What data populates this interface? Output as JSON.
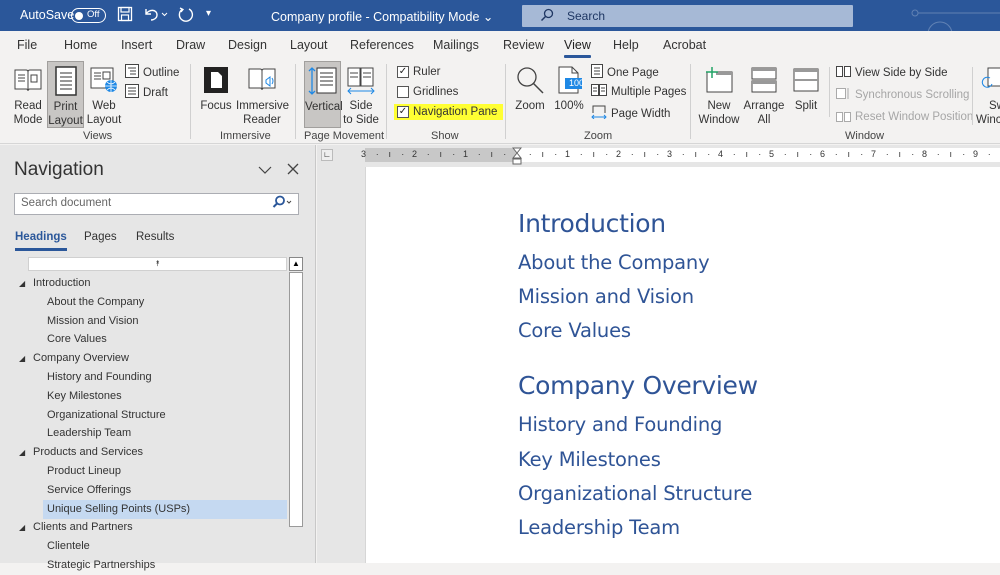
{
  "titlebar": {
    "autosave_label": "AutoSave",
    "autosave_state": "Off",
    "document_title": "Company profile  -  Compatibility Mode",
    "search_placeholder": "Search",
    "icons": [
      "save-icon",
      "undo-icon",
      "redo-icon",
      "customize-quick-access-icon"
    ]
  },
  "menu_tabs": [
    {
      "label": "File"
    },
    {
      "label": "Home"
    },
    {
      "label": "Insert"
    },
    {
      "label": "Draw"
    },
    {
      "label": "Design"
    },
    {
      "label": "Layout"
    },
    {
      "label": "References"
    },
    {
      "label": "Mailings"
    },
    {
      "label": "Review"
    },
    {
      "label": "View",
      "active": true
    },
    {
      "label": "Help"
    },
    {
      "label": "Acrobat"
    }
  ],
  "ribbon": {
    "views": {
      "label": "Views",
      "read_mode": "Read Mode",
      "print_layout_1": "Print",
      "print_layout_2": "Layout",
      "web_layout_1": "Web",
      "web_layout_2": "Layout",
      "read_mode_1": "Read",
      "read_mode_2": "Mode",
      "outline": "Outline",
      "draft": "Draft"
    },
    "immersive": {
      "label": "Immersive",
      "focus": "Focus",
      "reader_1": "Immersive",
      "reader_2": "Reader"
    },
    "page_movement": {
      "label": "Page Movement",
      "vertical": "Vertical",
      "side_1": "Side",
      "side_2": "to Side"
    },
    "show": {
      "label": "Show",
      "ruler": "Ruler",
      "ruler_checked": true,
      "gridlines": "Gridlines",
      "gridlines_checked": false,
      "navigation_pane": "Navigation Pane",
      "navigation_pane_checked": true
    },
    "zoom": {
      "label": "Zoom",
      "zoom": "Zoom",
      "hundred": "100%",
      "hundred_badge": "100",
      "one_page": "One Page",
      "multiple_pages": "Multiple Pages",
      "page_width": "Page Width"
    },
    "window": {
      "label": "Window",
      "new_1": "New",
      "new_2": "Window",
      "arrange_1": "Arrange",
      "arrange_2": "All",
      "split": "Split",
      "side_by_side": "View Side by Side",
      "sync_scroll": "Synchronous Scrolling",
      "reset_pos": "Reset Window Position",
      "switch_1": "Sw",
      "switch_2": "Winc"
    }
  },
  "navigation": {
    "title": "Navigation",
    "search_placeholder": "Search document",
    "tabs": [
      {
        "label": "Headings",
        "active": true
      },
      {
        "label": "Pages"
      },
      {
        "label": "Results"
      }
    ],
    "collapse_glyph": "⯭",
    "tree": [
      {
        "label": "Introduction",
        "level": 1
      },
      {
        "label": "About the Company",
        "level": 2
      },
      {
        "label": "Mission and Vision",
        "level": 2
      },
      {
        "label": "Core Values",
        "level": 2
      },
      {
        "label": "Company Overview",
        "level": 1
      },
      {
        "label": "History and Founding",
        "level": 2
      },
      {
        "label": "Key Milestones",
        "level": 2
      },
      {
        "label": "Organizational Structure",
        "level": 2
      },
      {
        "label": "Leadership Team",
        "level": 2
      },
      {
        "label": "Products and Services",
        "level": 1
      },
      {
        "label": "Product Lineup",
        "level": 2
      },
      {
        "label": "Service Offerings",
        "level": 2
      },
      {
        "label": "Unique Selling Points (USPs)",
        "level": 2,
        "selected": true
      },
      {
        "label": "Clients and Partners",
        "level": 1
      },
      {
        "label": "Clientele",
        "level": 2
      },
      {
        "label": "Strategic Partnerships",
        "level": 2
      }
    ]
  },
  "ruler": {
    "left_numbers": [
      "3",
      "2",
      "1"
    ],
    "right_numbers": [
      "1",
      "2",
      "3",
      "4",
      "5",
      "6",
      "7",
      "8",
      "9"
    ]
  },
  "document": {
    "headings": [
      {
        "text": "Introduction",
        "level": 1
      },
      {
        "text": "About the Company",
        "level": 2
      },
      {
        "text": "Mission and Vision",
        "level": 2
      },
      {
        "text": "Core Values",
        "level": 2
      },
      {
        "text": "Company Overview",
        "level": 1
      },
      {
        "text": "History and Founding",
        "level": 2
      },
      {
        "text": "Key Milestones",
        "level": 2
      },
      {
        "text": "Organizational Structure",
        "level": 2
      },
      {
        "text": "Leadership Team",
        "level": 2
      }
    ]
  },
  "colors": {
    "brand": "#2b579a",
    "heading": "#2f5496",
    "highlight": "#ffff33",
    "selection": "#c5d9f1"
  }
}
